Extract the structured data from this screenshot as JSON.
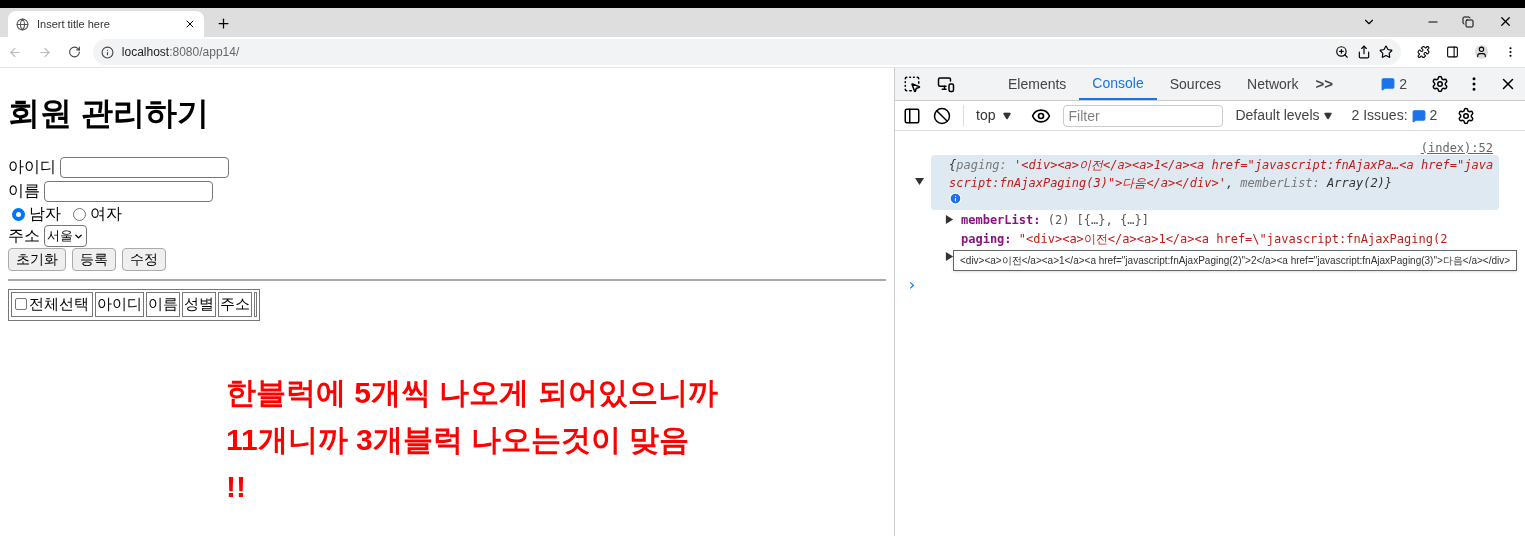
{
  "browser": {
    "tab_title": "Insert title here",
    "url_host": "localhost",
    "url_rest": ":8080/app14/"
  },
  "page": {
    "heading": "회원 관리하기",
    "fields": [
      {
        "label": "아이디"
      },
      {
        "label": "이름"
      }
    ],
    "gender": [
      {
        "label": "남자",
        "selected": true
      },
      {
        "label": "여자",
        "selected": false
      }
    ],
    "address": {
      "label": "주소",
      "value": "서울"
    },
    "buttons": [
      "초기화",
      "등록",
      "수정"
    ],
    "table": {
      "select_all": {
        "label": "전체선택",
        "checked": false
      },
      "columns": [
        "아이디",
        "이름",
        "성별",
        "주소"
      ]
    },
    "annotation": [
      "한블럭에 5개씩 나오게 되어있으니까",
      "11개니까 3개블럭 나오는것이 맞음",
      "!!"
    ]
  },
  "devtools": {
    "tabs": [
      {
        "label": "Elements",
        "selected": false
      },
      {
        "label": "Console",
        "selected": true
      },
      {
        "label": "Sources",
        "selected": false
      },
      {
        "label": "Network",
        "selected": false
      }
    ],
    "overflow": ">>",
    "messages_count": "2",
    "context": "top",
    "filter_placeholder": "Filter",
    "levels": "Default levels",
    "issues_label": "2 Issues:",
    "issues_count": "2",
    "log": {
      "source": "(index):52",
      "expanded": true,
      "summary": [
        {
          "kind": "punct",
          "text": "{"
        },
        {
          "kind": "key",
          "text": "paging: "
        },
        {
          "kind": "string",
          "text": "'<div><a>이전</a><a>1</a><a href=\"javascript:fnAjaxPa…<a href=\"javascript:fnAjaxPaging(3)\">다음</a></div>'"
        },
        {
          "kind": "punct",
          "text": ", "
        },
        {
          "kind": "key",
          "text": "memberList: "
        },
        {
          "kind": "plain",
          "text": "Array(2)}"
        }
      ],
      "properties": [
        {
          "key": "memberList:",
          "value": "(2) [{…}, {…}]",
          "kind": "plain",
          "expandable": true
        },
        {
          "key": "paging:",
          "value": "\"<div><a>이전</a><a>1</a><a href=\\\"javascript:fnAjaxPaging(2",
          "kind": "string",
          "expandable": false
        }
      ],
      "tooltip": "<div><a>이전</a><a>1</a><a href=\"javascript:fnAjaxPaging(2)\">2</a><a href=\"javascript:fnAjaxPaging(3)\">다음</a></div>"
    },
    "prompt": "›"
  }
}
